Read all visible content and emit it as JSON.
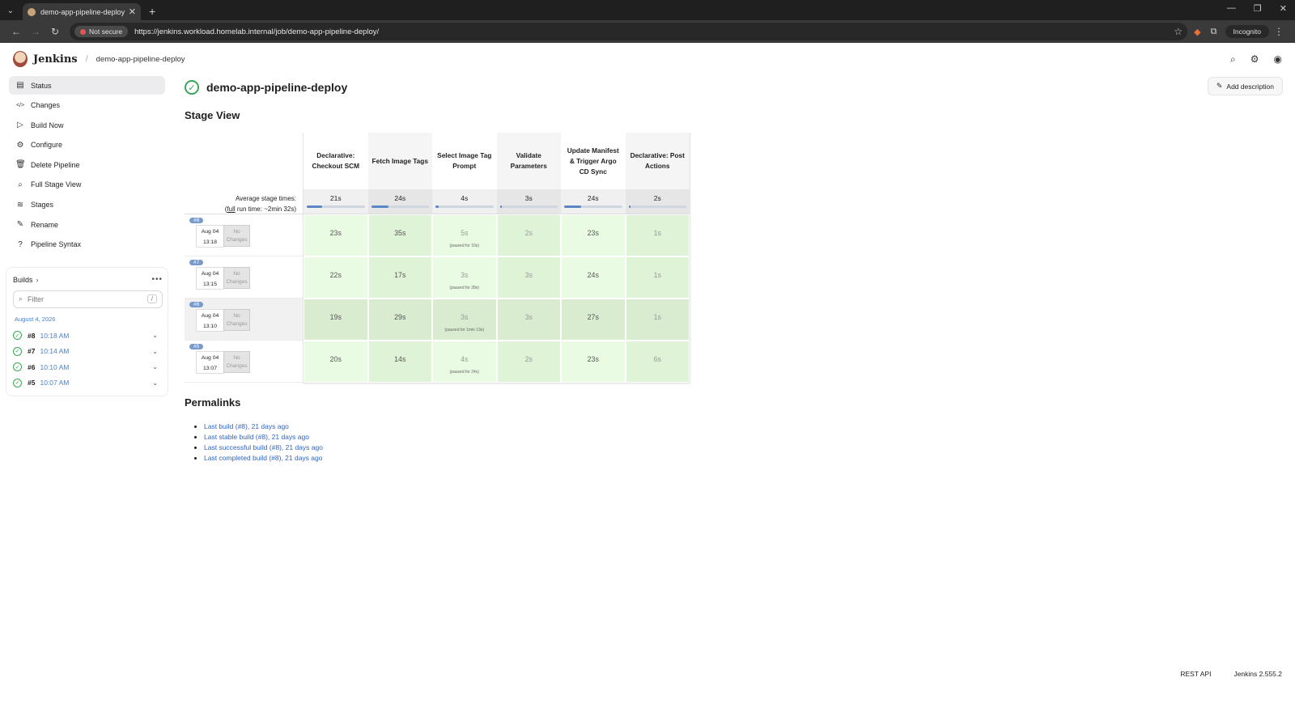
{
  "browser": {
    "tab_title": "demo-app-pipeline-deploy - Je",
    "not_secure": "Not secure",
    "url": "https://jenkins.workload.homelab.internal/job/demo-app-pipeline-deploy/",
    "incognito": "Incognito"
  },
  "header": {
    "brand": "Jenkins",
    "breadcrumb": "demo-app-pipeline-deploy"
  },
  "sidebar": {
    "items": [
      {
        "label": "Status",
        "icon": "status-icon"
      },
      {
        "label": "Changes",
        "icon": "code-icon"
      },
      {
        "label": "Build Now",
        "icon": "play-icon"
      },
      {
        "label": "Configure",
        "icon": "gear-icon"
      },
      {
        "label": "Delete Pipeline",
        "icon": "trash-icon"
      },
      {
        "label": "Full Stage View",
        "icon": "search-icon"
      },
      {
        "label": "Stages",
        "icon": "layers-icon"
      },
      {
        "label": "Rename",
        "icon": "pencil-icon"
      },
      {
        "label": "Pipeline Syntax",
        "icon": "help-icon"
      }
    ]
  },
  "builds": {
    "title": "Builds",
    "filter_placeholder": "Filter",
    "filter_shortcut": "/",
    "date": "August 4, 2026",
    "list": [
      {
        "num": "#8",
        "time": "10:18 AM"
      },
      {
        "num": "#7",
        "time": "10:14 AM"
      },
      {
        "num": "#6",
        "time": "10:10 AM"
      },
      {
        "num": "#5",
        "time": "10:07 AM"
      }
    ]
  },
  "main": {
    "title": "demo-app-pipeline-deploy",
    "add_description": "Add description",
    "stage_view_title": "Stage View",
    "avg_label": "Average stage times:",
    "avg_full": "full",
    "avg_run_time": " run time: ~2min 32s)",
    "stages": [
      {
        "name": "Declarative: Checkout SCM",
        "avg": "21s",
        "bar": 0.27
      },
      {
        "name": "Fetch Image Tags",
        "avg": "24s",
        "bar": 0.3
      },
      {
        "name": "Select Image Tag Prompt",
        "avg": "4s",
        "bar": 0.05
      },
      {
        "name": "Validate Parameters",
        "avg": "3s",
        "bar": 0.04
      },
      {
        "name": "Update Manifest & Trigger Argo CD Sync",
        "avg": "24s",
        "bar": 0.3
      },
      {
        "name": "Declarative: Post Actions",
        "avg": "2s",
        "bar": 0.03
      }
    ],
    "runs": [
      {
        "badge": "#8",
        "date": "Aug 04",
        "time": "13:18",
        "changes": "No Changes",
        "cells": [
          "23s",
          "35s",
          "5s",
          "2s",
          "23s",
          "1s"
        ],
        "pause": "(paused for 10s)"
      },
      {
        "badge": "#7",
        "date": "Aug 04",
        "time": "13:15",
        "changes": "No Changes",
        "cells": [
          "22s",
          "17s",
          "3s",
          "3s",
          "24s",
          "1s"
        ],
        "pause": "(paused for 28s)"
      },
      {
        "badge": "#6",
        "date": "Aug 04",
        "time": "13:10",
        "changes": "No Changes",
        "cells": [
          "19s",
          "29s",
          "3s",
          "3s",
          "27s",
          "1s"
        ],
        "pause": "(paused for 1min 13s)"
      },
      {
        "badge": "#5",
        "date": "Aug 04",
        "time": "13:07",
        "changes": "No Changes",
        "cells": [
          "20s",
          "14s",
          "4s",
          "2s",
          "23s",
          "6s"
        ],
        "pause": "(paused for 24s)"
      }
    ],
    "permalinks_title": "Permalinks",
    "permalinks": [
      "Last build (#8), 21 days ago",
      "Last stable build (#8), 21 days ago",
      "Last successful build (#8), 21 days ago",
      "Last completed build (#8), 21 days ago"
    ]
  },
  "footer": {
    "rest_api": "REST API",
    "version": "Jenkins 2.555.2"
  },
  "colors": {
    "success": "#3aa655",
    "link": "#2f64c2",
    "cell_green": "#eafbe3"
  }
}
